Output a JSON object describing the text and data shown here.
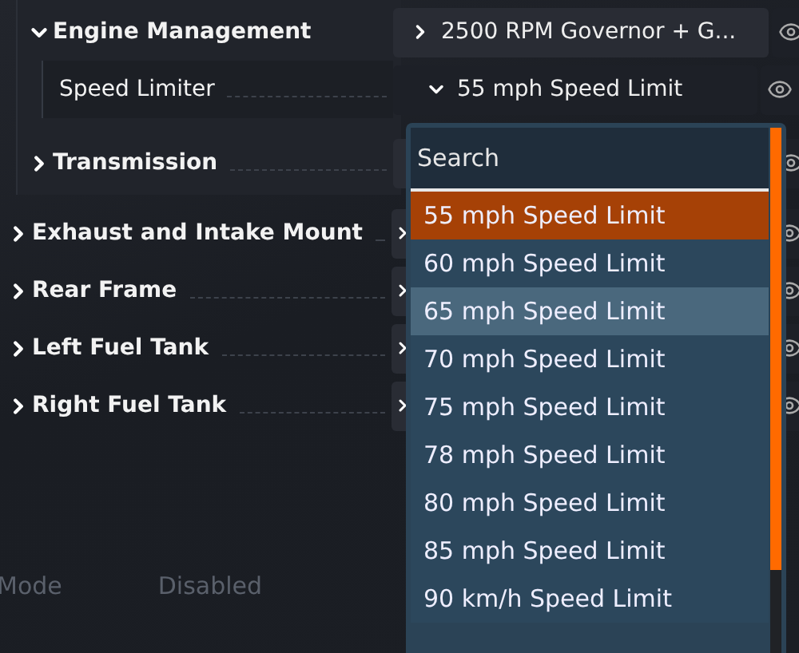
{
  "tree": [
    {
      "label": "Engine Management",
      "expanded": true,
      "value": {
        "text": "2500 RPM Governor + G...",
        "open": false
      },
      "children": [
        {
          "label": "Speed Limiter",
          "value": {
            "text": "55 mph Speed Limit",
            "open": true
          }
        }
      ]
    },
    {
      "label": "Transmission",
      "expanded": false
    },
    {
      "label": "Exhaust and Intake Mount",
      "expanded": false
    },
    {
      "label": "Rear Frame",
      "expanded": false
    },
    {
      "label": "Left Fuel Tank",
      "expanded": false
    },
    {
      "label": "Right Fuel Tank",
      "expanded": false
    }
  ],
  "dropdown": {
    "search": {
      "placeholder": "Search"
    },
    "options": [
      {
        "label": "55 mph Speed Limit",
        "selected": true,
        "highlighted": false
      },
      {
        "label": "60 mph Speed Limit",
        "selected": false,
        "highlighted": false
      },
      {
        "label": "65 mph Speed Limit",
        "selected": false,
        "highlighted": true
      },
      {
        "label": "70 mph Speed Limit",
        "selected": false,
        "highlighted": false
      },
      {
        "label": "75 mph Speed Limit",
        "selected": false,
        "highlighted": false
      },
      {
        "label": "78 mph Speed Limit",
        "selected": false,
        "highlighted": false
      },
      {
        "label": "80 mph Speed Limit",
        "selected": false,
        "highlighted": false
      },
      {
        "label": "85 mph Speed Limit",
        "selected": false,
        "highlighted": false
      },
      {
        "label": "90 km/h Speed Limit",
        "selected": false,
        "highlighted": false
      }
    ]
  },
  "footer": {
    "label": "Mode",
    "value": "Disabled"
  }
}
